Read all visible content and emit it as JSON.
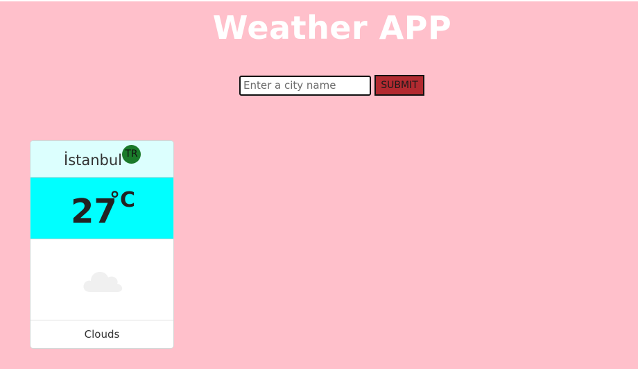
{
  "header": {
    "title": "Weather APP"
  },
  "search": {
    "placeholder": "Enter a city name",
    "value": "",
    "submit_label": "SUBMIT"
  },
  "cards": [
    {
      "city": "İstanbul",
      "country": "TR",
      "temperature": "27",
      "unit": "°C",
      "icon": "cloud-icon",
      "description": "Clouds"
    }
  ],
  "colors": {
    "background": "#ffc0cb",
    "submit_button": "#b22a30",
    "card_header": "#dcfffe",
    "temp_area": "#00ffff",
    "country_badge": "#1a7a2a",
    "cloud": "#f0f0f0"
  }
}
